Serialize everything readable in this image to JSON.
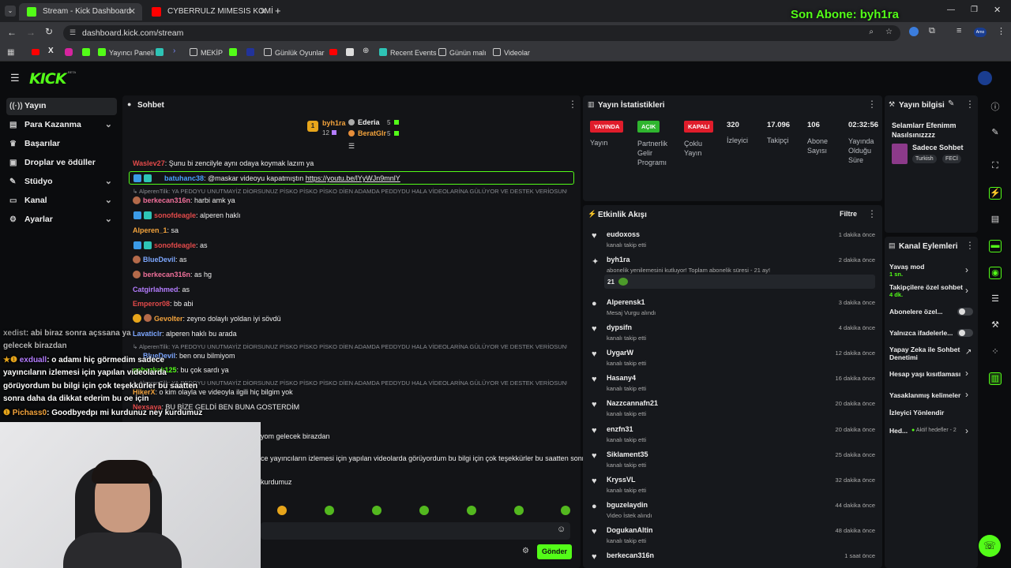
{
  "browser": {
    "tabs": [
      {
        "title": "Stream - Kick Dashboard"
      },
      {
        "title": "CYBERRULZ MIMESIS KOMİK AN"
      }
    ],
    "url": "dashboard.kick.com/stream",
    "bookmarks": [
      "Yayıncı Paneli",
      "MEKİP",
      "Günlük Oyunlar",
      "Recent Events",
      "Günün malı",
      "Videolar"
    ],
    "profile_label": "Arno"
  },
  "overlay": {
    "last_sub": "Son Abone: byh1ra",
    "chat_lines": [
      {
        "user": "xedist",
        "text": ": abi biraz sonra açssana ya"
      },
      {
        "text": "gelecek birazdan"
      },
      {
        "user": "exduall",
        "text": ": o adamı hiç görmedim sadece"
      },
      {
        "text": "yayıncıların izlemesi için yapılan videolarda"
      },
      {
        "text": "görüyordum bu bilgi için çok teşekkürler bu saatten"
      },
      {
        "text": "sonra daha da dikkat ederim bu oe için"
      },
      {
        "user": "Pichass0",
        "text": ": Goodbyedpı mi kurdunuz ney kurdumuz"
      }
    ]
  },
  "header": {
    "logo": "KICK",
    "beta": "BETA"
  },
  "sidebar": {
    "items": [
      {
        "label": "Yayın",
        "icon": "broadcast-icon"
      },
      {
        "label": "Para Kazanma",
        "icon": "money-icon"
      },
      {
        "label": "Başarılar",
        "icon": "trophy-icon"
      },
      {
        "label": "Droplar ve ödüller",
        "icon": "gift-icon"
      },
      {
        "label": "Stüdyo",
        "icon": "studio-icon"
      },
      {
        "label": "Kanal",
        "icon": "channel-icon"
      },
      {
        "label": "Ayarlar",
        "icon": "gear-icon"
      }
    ]
  },
  "chat": {
    "title": "Sohbet",
    "top_gifters": {
      "left": {
        "name": "byh1ra",
        "count": "12"
      },
      "right": [
        {
          "name": "Ederia",
          "count": "5"
        },
        {
          "name": "BeratGlr",
          "count": "5"
        }
      ]
    },
    "messages": [
      {
        "user": "Waslev27",
        "color": "#e34a4a",
        "text": ": Şunu bi zencilyle aynı odaya koymak lazım ya"
      },
      {
        "user": "batuhanc38",
        "color": "#4aa0ff",
        "text": ": @maskar videoyu kapatmıştın",
        "link": "https://youtu.be/lYyWJn9mnlY",
        "highlight": true
      },
      {
        "reply": "AlperenTilk: YA PEDOYU UNUTMAYİZ DİORSUNUZ PİSKO PİSKO PİSKO DİEN ADAMDA PEDDYDU HALA VİDEOLARİNA GÜLÜYOR VE DESTEK VERİOSUNUZ ..."
      },
      {
        "user": "berkecan316n",
        "color": "#f0709a",
        "text": ": harbi amk ya"
      },
      {
        "user": "sonofdeagle",
        "color": "#e34a4a",
        "text": ": alperen haklı"
      },
      {
        "user": "Alperen_1",
        "color": "#f3a33c",
        "text": ": sa"
      },
      {
        "user": "sonofdeagle",
        "color": "#e34a4a",
        "text": ": as"
      },
      {
        "user": "BlueDevil",
        "color": "#7da7ff",
        "text": ": as"
      },
      {
        "user": "berkecan316n",
        "color": "#f0709a",
        "text": ": as hg"
      },
      {
        "user": "Catgirlahmed",
        "color": "#b47dff",
        "text": ": as"
      },
      {
        "user": "Emperor08",
        "color": "#e34a4a",
        "text": ": bb abi"
      },
      {
        "user": "Gevolter",
        "color": "#f3a33c",
        "text": ": zeyno dolaylı yoldan iyi sövdü"
      },
      {
        "user": "Lavaticlr",
        "color": "#7da7ff",
        "text": ": alperen haklı bu arada"
      },
      {
        "reply": "AlperenTilk: YA PEDOYU UNUTMAYİZ DİORSUNUZ PİSKO PİSKO PİSKO DİEN ADAMDA PEDDYDU HALA VİDEOLARİNA GÜLÜYOR VE DESTEK VERİOSUNUZ ..."
      },
      {
        "user": "BlueDevil",
        "color": "#7da7ff",
        "text": ": ben onu bilmiyom"
      },
      {
        "user": "gabezkak125",
        "color": "#53fc18",
        "text": ": bu çok sardı ya"
      },
      {
        "reply": "AlperenTilk: YA PEDOYU UNUTMAYİZ DİORSUNUZ PİSKO PİSKO PİSKO DİEN ADAMDA PEDDYDU HALA VİDEOLARİNA GÜLÜYOR VE DESTEK VERİOSUNUZ ..."
      },
      {
        "user": "HikerX",
        "color": "#f3a33c",
        "text": ": o kim olayla ve videoyla ilgili hiç bilgim yok"
      },
      {
        "user": "Nexsaya",
        "color": "#e34a4a",
        "text": ": BU BİZE GELDİ BEN BUNA GOSTERDİM"
      },
      {
        "text": "yom gelecek birazdan"
      },
      {
        "text": "ce yayıncıların izlemesi için yapılan videolarda görüyordum bu bilgi için çok teşekkürler bu saatten sonra"
      },
      {
        "text": "kurdumuz"
      }
    ],
    "send_label": "Gönder"
  },
  "stats": {
    "title": "Yayın İstatistikleri",
    "items": [
      {
        "badge": "YAYINDA",
        "badge_color": "#e01d2b",
        "label": "Yayın"
      },
      {
        "badge": "AÇIK",
        "badge_color": "#2fb52f",
        "label": "Partnerlik Gelir Programı"
      },
      {
        "badge": "KAPALI",
        "badge_color": "#e01d2b",
        "label": "Çoklu Yayın"
      },
      {
        "value": "320",
        "label": "İzleyici"
      },
      {
        "value": "17.096",
        "label": "Takipçi"
      },
      {
        "value": "106",
        "label": "Abone Sayısı"
      },
      {
        "value": "02:32:56",
        "label": "Yayında Olduğu Süre"
      }
    ]
  },
  "stream_info": {
    "title": "Yayın bilgisi",
    "stream_title": "Selamlarr Efenimm Nasılsınızzzz",
    "category": "Sadece Sohbet",
    "tags": [
      "Turkish",
      "FECİ"
    ]
  },
  "activity": {
    "title": "Etkinlik Akışı",
    "filter_label": "Filtre",
    "events": [
      {
        "name": "eudoxoss",
        "sub": "kanalı takip etti",
        "time": "1 dakika önce",
        "icon": "heart-icon"
      },
      {
        "name": "byh1ra",
        "sub": "abonelik yenilemesini kutluyor! Toplam abonelik süresi - 21 ay!",
        "time": "2 dakika önce",
        "icon": "party-icon",
        "extra": "21"
      },
      {
        "name": "Alperensk1",
        "sub": "Mesaj Vurgu alındı",
        "time": "3 dakika önce",
        "icon": "reward-icon"
      },
      {
        "name": "dypsifn",
        "sub": "kanalı takip etti",
        "time": "4 dakika önce",
        "icon": "heart-icon"
      },
      {
        "name": "UygarW",
        "sub": "kanalı takip etti",
        "time": "12 dakika önce",
        "icon": "heart-icon"
      },
      {
        "name": "Hasany4",
        "sub": "kanalı takip etti",
        "time": "16 dakika önce",
        "icon": "heart-icon"
      },
      {
        "name": "Nazzcannafn21",
        "sub": "kanalı takip etti",
        "time": "20 dakika önce",
        "icon": "heart-icon"
      },
      {
        "name": "enzfn31",
        "sub": "kanalı takip etti",
        "time": "20 dakika önce",
        "icon": "heart-icon"
      },
      {
        "name": "Siklament35",
        "sub": "kanalı takip etti",
        "time": "25 dakika önce",
        "icon": "heart-icon"
      },
      {
        "name": "KryssVL",
        "sub": "kanalı takip etti",
        "time": "32 dakika önce",
        "icon": "heart-icon"
      },
      {
        "name": "bguzelaydin",
        "sub": "Video İstek alındı",
        "time": "44 dakika önce",
        "icon": "reward-icon"
      },
      {
        "name": "DogukanAltin",
        "sub": "kanalı takip etti",
        "time": "48 dakika önce",
        "icon": "heart-icon"
      },
      {
        "name": "berkecan316n",
        "sub": "",
        "time": "1 saat önce",
        "icon": "heart-icon"
      }
    ]
  },
  "channel_actions": {
    "title": "Kanal Eylemleri",
    "items": [
      {
        "label": "Yavaş mod",
        "sub": "1 sn.",
        "control": "chevron"
      },
      {
        "label": "Takipçilere özel sohbet",
        "sub": "4 dk.",
        "control": "chevron"
      },
      {
        "label": "Abonelere özel...",
        "control": "toggle"
      },
      {
        "label": "Yalnızca ifadelerle...",
        "control": "toggle"
      },
      {
        "label": "Yapay Zeka ile Sohbet Denetimi",
        "control": "external"
      },
      {
        "label": "Hesap yaşı kısıtlaması",
        "control": "chevron"
      },
      {
        "label": "Yasaklanmış kelimeler",
        "control": "chevron"
      },
      {
        "label": "İzleyici Yönlendir",
        "control": "none"
      },
      {
        "label": "Hed...",
        "sub": "Aktif hedefler - 2",
        "control": "chevron"
      }
    ]
  }
}
